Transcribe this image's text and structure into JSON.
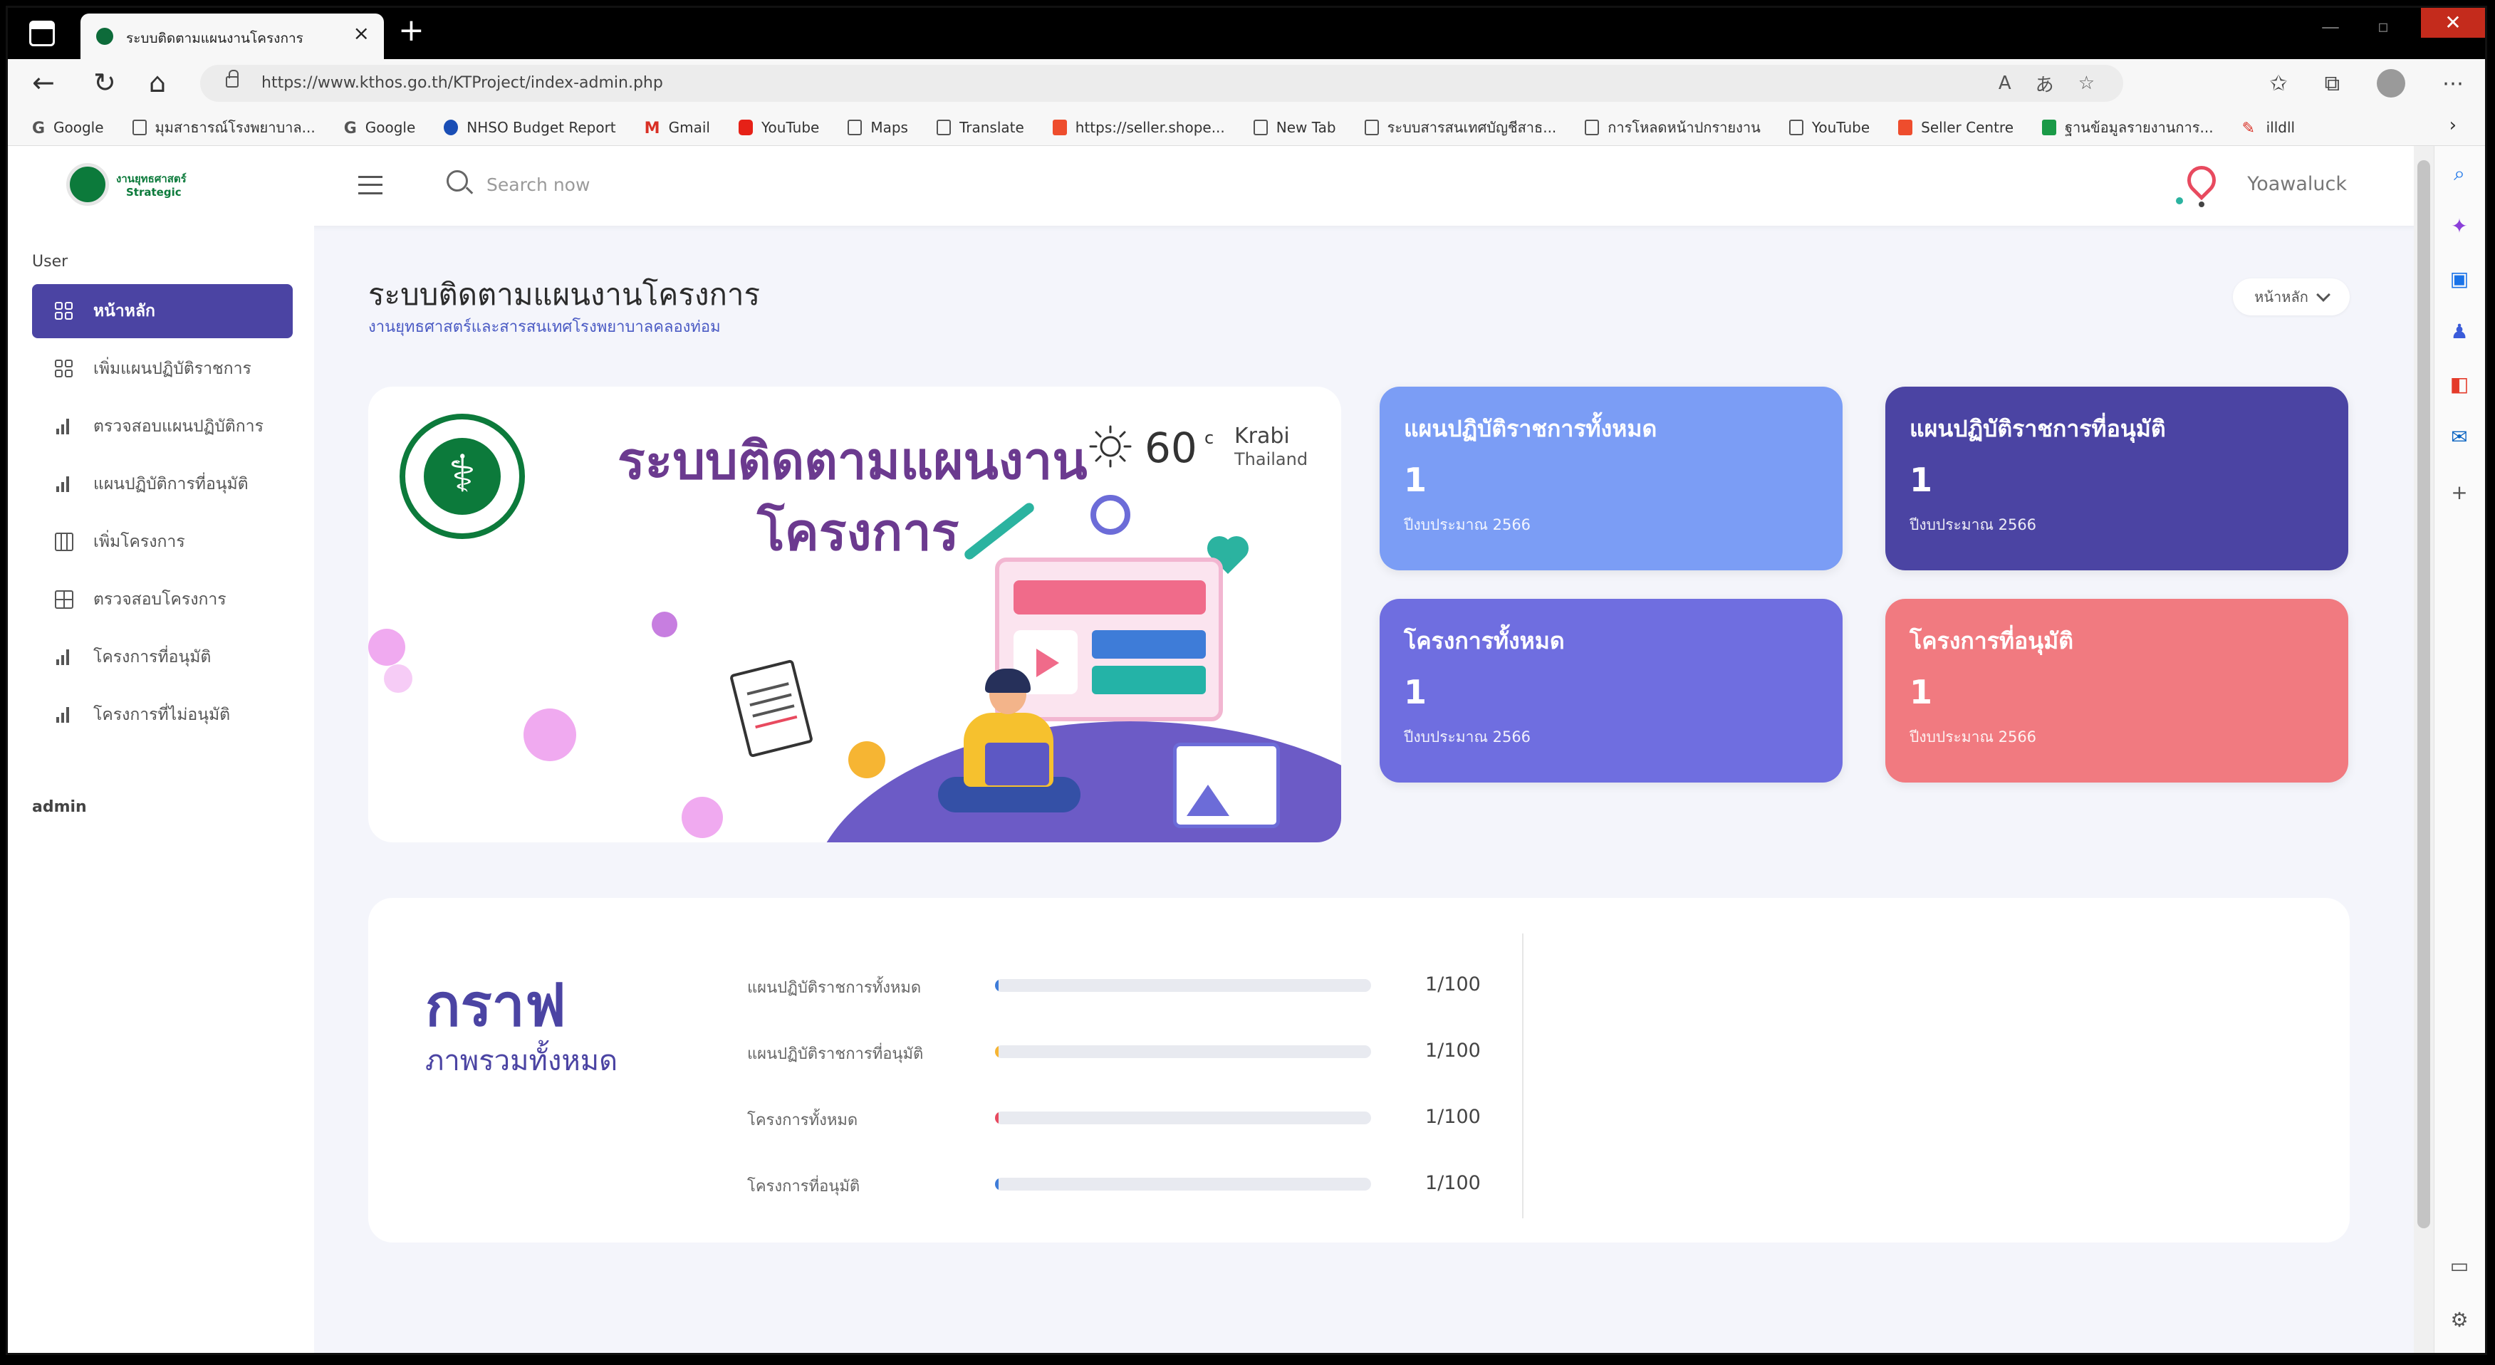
{
  "browser": {
    "tab_title": "ระบบติดตามแผนงานโครงการ",
    "url": "https://www.kthos.go.th/KTProject/index-admin.php",
    "bookmarks": [
      {
        "label": "Google",
        "icon": "google-icon"
      },
      {
        "label": "มุมสาธารณ์โรงพยาบาล...",
        "icon": "page-icon"
      },
      {
        "label": "Google",
        "icon": "google-icon"
      },
      {
        "label": "NHSO Budget Report",
        "icon": "nhso-icon"
      },
      {
        "label": "Gmail",
        "icon": "gmail-icon"
      },
      {
        "label": "YouTube",
        "icon": "youtube-icon"
      },
      {
        "label": "Maps",
        "icon": "page-icon"
      },
      {
        "label": "Translate",
        "icon": "page-icon"
      },
      {
        "label": "https://seller.shope...",
        "icon": "shopee-icon"
      },
      {
        "label": "New Tab",
        "icon": "page-icon"
      },
      {
        "label": "ระบบสารสนเทศบัญชีสาธ...",
        "icon": "page-icon"
      },
      {
        "label": "การโหลดหน้าปกรายงาน",
        "icon": "page-icon"
      },
      {
        "label": "YouTube",
        "icon": "page-icon"
      },
      {
        "label": "Seller Centre",
        "icon": "shopee-icon"
      },
      {
        "label": "ฐานข้อมูลรายงานการ...",
        "icon": "sheets-icon"
      },
      {
        "label": "illdll",
        "icon": "pen-icon"
      }
    ]
  },
  "header": {
    "logo_line1": "งานยุทธศาสตร์",
    "logo_line2": "Strategic",
    "search_placeholder": "Search now",
    "user_name": "Yoawaluck"
  },
  "sidebar": {
    "section_user": "User",
    "section_admin": "admin",
    "items": [
      {
        "label": "หน้าหลัก",
        "icon": "grid-icon",
        "active": true
      },
      {
        "label": "เพิ่มแผนปฏิบัติราชการ",
        "icon": "grid-icon",
        "active": false
      },
      {
        "label": "ตรวจสอบแผนปฏิบัติการ",
        "icon": "bar-chart-icon",
        "active": false
      },
      {
        "label": "แผนปฏิบัติการที่อนุมัติ",
        "icon": "bar-chart-icon",
        "active": false
      },
      {
        "label": "เพิ่มโครงการ",
        "icon": "columns-icon",
        "active": false
      },
      {
        "label": "ตรวจสอบโครงการ",
        "icon": "table-icon",
        "active": false
      },
      {
        "label": "โครงการที่อนุมัติ",
        "icon": "bar-chart-icon",
        "active": false
      },
      {
        "label": "โครงการที่ไม่อนุมัติ",
        "icon": "bar-chart-icon",
        "active": false
      }
    ]
  },
  "main": {
    "title": "ระบบติดตามแผนงานโครงการ",
    "subtitle": "งานยุทธศาสตร์และสารสนเทศโรงพยาบาลคลองท่อม",
    "breadcrumb": "หน้าหลัก"
  },
  "banner": {
    "title_line1": "ระบบติดตามแผนงาน",
    "title_line2": "โครงการ",
    "weather_temp": "60",
    "weather_unit": "c",
    "weather_city": "Krabi",
    "weather_country": "Thailand"
  },
  "stats": [
    {
      "label": "แผนปฏิบัติราชการทั้งหมด",
      "value": "1",
      "sub": "ปีงบประมาณ 2566",
      "color": "#7b9df5"
    },
    {
      "label": "แผนปฏิบัติราชการที่อนุมัติ",
      "value": "1",
      "sub": "ปีงบประมาณ 2566",
      "color": "#4b44a3"
    },
    {
      "label": "โครงการทั้งหมด",
      "value": "1",
      "sub": "ปีงบประมาณ 2566",
      "color": "#6f6ee0"
    },
    {
      "label": "โครงการที่อนุมัติ",
      "value": "1",
      "sub": "ปีงบประมาณ 2566",
      "color": "#f17a80"
    }
  ],
  "graph": {
    "title": "กราฟ",
    "subtitle": "ภาพรวมทั้งหมด",
    "rows": [
      {
        "label": "แผนปฏิบัติราชการทั้งหมด",
        "value_text": "1/100",
        "fraction": 0.01,
        "color": "#3e7cd8"
      },
      {
        "label": "แผนปฏิบัติราชการที่อนุมัติ",
        "value_text": "1/100",
        "fraction": 0.01,
        "color": "#f6b533"
      },
      {
        "label": "โครงการทั้งหมด",
        "value_text": "1/100",
        "fraction": 0.01,
        "color": "#e84a5f"
      },
      {
        "label": "โครงการที่อนุมัติ",
        "value_text": "1/100",
        "fraction": 0.01,
        "color": "#3e7cd8"
      }
    ]
  }
}
